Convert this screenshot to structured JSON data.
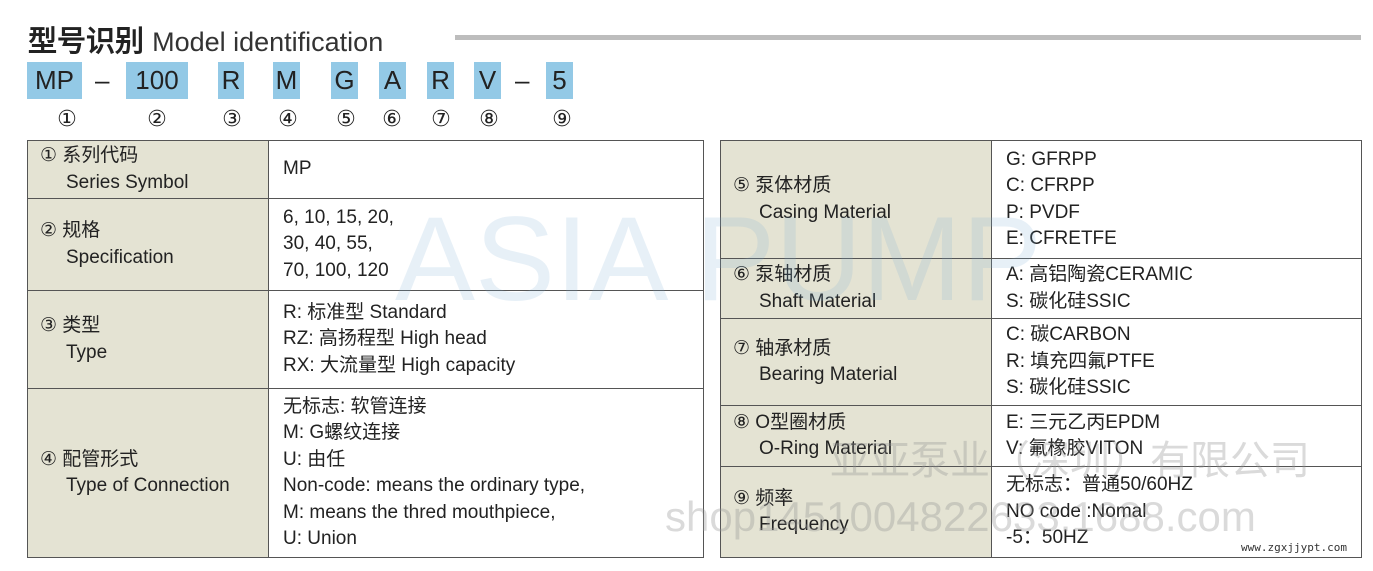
{
  "title": {
    "cn": "型号识别",
    "en": "Model identification"
  },
  "codes": [
    "MP",
    "100",
    "R",
    "M",
    "G",
    "A",
    "R",
    "V",
    "5"
  ],
  "dash": "–",
  "numbers": [
    "①",
    "②",
    "③",
    "④",
    "⑤",
    "⑥",
    "⑦",
    "⑧",
    "⑨"
  ],
  "left_rows": [
    {
      "cn": "① 系列代码",
      "en": "Series Symbol",
      "values": [
        "MP"
      ]
    },
    {
      "cn": "② 规格",
      "en": "Specification",
      "values": [
        "6, 10, 15, 20,",
        "30, 40, 55,",
        "70, 100, 120"
      ]
    },
    {
      "cn": "③ 类型",
      "en": "Type",
      "values": [
        "R: 标准型 Standard",
        "RZ: 高扬程型 High head",
        "RX: 大流量型 High capacity"
      ]
    },
    {
      "cn": "④ 配管形式",
      "en": "Type of Connection",
      "values": [
        "无标志: 软管连接",
        "M: G螺纹连接",
        "U: 由任",
        "Non-code: means the ordinary type,",
        "M: means the thred mouthpiece,",
        "U: Union"
      ]
    }
  ],
  "right_rows": [
    {
      "cn": "⑤ 泵体材质",
      "en": "Casing Material",
      "values": [
        "G: GFRPP",
        "C: CFRPP",
        "P: PVDF",
        "E: CFRETFE"
      ]
    },
    {
      "cn": "⑥ 泵轴材质",
      "en": "Shaft Material",
      "values": [
        "A: 高铝陶瓷CERAMIC",
        "S: 碳化硅SSIC"
      ]
    },
    {
      "cn": "⑦ 轴承材质",
      "en": "Bearing Material",
      "values": [
        "C: 碳CARBON",
        "R: 填充四氟PTFE",
        "S: 碳化硅SSIC"
      ]
    },
    {
      "cn": "⑧ O型圈材质",
      "en": "O-Ring Material",
      "values": [
        "E: 三元乙丙EPDM",
        "V: 氟橡胶VITON"
      ]
    },
    {
      "cn": "⑨ 频率",
      "en": "Frequency",
      "values": [
        "无标志：普通50/60HZ",
        "NO code :Nomal",
        "-5：50HZ"
      ]
    }
  ],
  "watermarks": {
    "brand": "ASIA PUMP",
    "company": "亚亚泵业（深圳）有限公司",
    "shop": "shop1451004822633.1688.com"
  },
  "site": "www.zgxjjypt.com",
  "colors": {
    "code_bg": "#93c9e6",
    "label_bg": "#e4e3d3"
  }
}
